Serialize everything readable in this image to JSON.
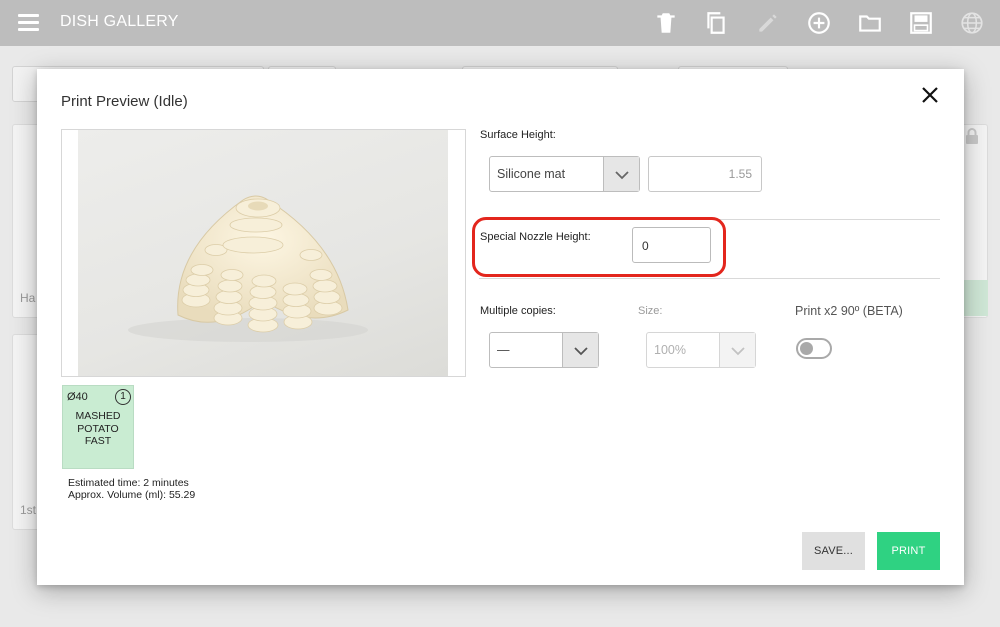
{
  "appbar": {
    "title": "DISH GALLERY",
    "icons": [
      "menu-icon",
      "trash-icon",
      "copy-icon",
      "pencil-icon",
      "add-circle-icon",
      "folder-icon",
      "save-disk-icon",
      "globe-icon"
    ]
  },
  "background": {
    "card1_text": "Ha",
    "card2_text": "1st"
  },
  "modal": {
    "title": "Print Preview (Idle)",
    "capsule": {
      "size": "Ø40",
      "count": "1",
      "name": "MASHED\nPOTATO\nFAST",
      "color": "#c9ecd2"
    },
    "estimated_time": "Estimated time: 2 minutes",
    "approx_volume": "Approx. Volume (ml): 55.29",
    "surface_height": {
      "label": "Surface Height:",
      "selected": "Silicone mat",
      "value": "1.55"
    },
    "special_nozzle": {
      "label": "Special Nozzle Height:",
      "value": "0",
      "highlight_color": "#e3261d"
    },
    "multiple_copies": {
      "label": "Multiple copies:",
      "selected": "—"
    },
    "size": {
      "label": "Size:",
      "selected": "100%"
    },
    "print_x2": {
      "label": "Print x2 90º (BETA)",
      "enabled": false
    },
    "buttons": {
      "save": "SAVE...",
      "print": "PRINT"
    },
    "accent_color": "#2fd282"
  }
}
